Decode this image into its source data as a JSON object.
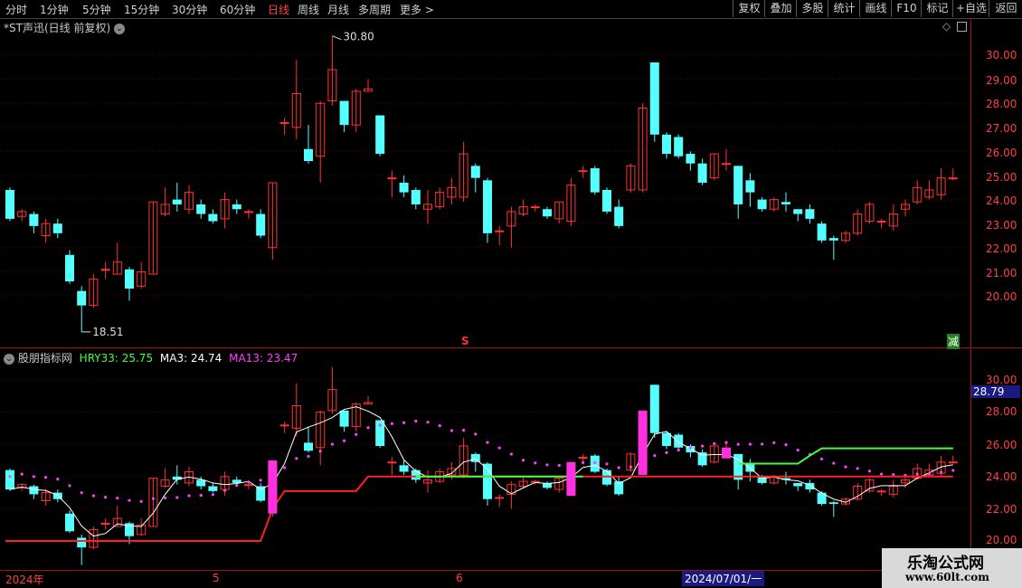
{
  "topbar": {
    "periods": [
      "分时",
      "1分钟",
      "5分钟",
      "15分钟",
      "30分钟",
      "60分钟",
      "日线",
      "周线",
      "月线",
      "多周期",
      "更多 >"
    ],
    "active_period": "日线",
    "right_buttons": [
      "复权",
      "叠加",
      "多股",
      "统计",
      "画线",
      "F10",
      "标记",
      "+自选",
      "返回"
    ]
  },
  "main_chart": {
    "title": "*ST声迅(日线 前复权)",
    "high_label": "30.80",
    "low_label": "18.51",
    "y_ticks": [
      "30.00",
      "29.00",
      "28.00",
      "27.00",
      "26.00",
      "25.00",
      "24.00",
      "23.00",
      "22.00",
      "21.00",
      "20.00"
    ],
    "marker_s": "S",
    "marker_jian": "减"
  },
  "indicator": {
    "name": "股朋指标网",
    "hry_label": "HRY33: 25.75",
    "ma3_label": "MA3: 24.74",
    "ma13_label": "MA13: 23.47",
    "y_ticks": [
      "30.00",
      "28.00",
      "26.00",
      "24.00",
      "22.00",
      "20.00"
    ],
    "current_value": "28.79",
    "colors": {
      "hry": "#40ff40",
      "ma3": "#ffffff",
      "ma13": "#ff40ff",
      "support": "#ff2020"
    }
  },
  "date_axis": {
    "labels": [
      "2024年",
      "5",
      "6",
      "2024/07/01/一"
    ]
  },
  "watermark": {
    "title": "乐淘公式网",
    "url": "www.60lt.com"
  },
  "chart_data": {
    "type": "candlestick",
    "candles": [
      {
        "o": 24.4,
        "c": 23.2,
        "h": 24.5,
        "l": 23.1
      },
      {
        "o": 23.3,
        "c": 23.5,
        "h": 23.6,
        "l": 23.1
      },
      {
        "o": 23.4,
        "c": 22.9,
        "h": 23.5,
        "l": 22.6
      },
      {
        "o": 22.5,
        "c": 23.0,
        "h": 23.2,
        "l": 22.2
      },
      {
        "o": 23.0,
        "c": 22.6,
        "h": 23.2,
        "l": 22.4
      },
      {
        "o": 21.7,
        "c": 20.6,
        "h": 21.9,
        "l": 20.5
      },
      {
        "o": 20.2,
        "c": 19.6,
        "h": 20.4,
        "l": 18.5
      },
      {
        "o": 19.6,
        "c": 20.7,
        "h": 20.9,
        "l": 19.5
      },
      {
        "o": 21.1,
        "c": 21.1,
        "h": 21.4,
        "l": 20.7
      },
      {
        "o": 20.9,
        "c": 21.4,
        "h": 22.2,
        "l": 20.9
      },
      {
        "o": 21.1,
        "c": 20.3,
        "h": 21.2,
        "l": 19.8
      },
      {
        "o": 20.4,
        "c": 21.0,
        "h": 21.4,
        "l": 20.3
      },
      {
        "o": 20.9,
        "c": 23.9,
        "h": 23.9,
        "l": 20.9
      },
      {
        "o": 23.4,
        "c": 23.8,
        "h": 24.5,
        "l": 23.3
      },
      {
        "o": 24.0,
        "c": 23.8,
        "h": 24.7,
        "l": 23.5
      },
      {
        "o": 23.6,
        "c": 24.3,
        "h": 24.6,
        "l": 23.4
      },
      {
        "o": 23.8,
        "c": 23.4,
        "h": 24.0,
        "l": 23.2
      },
      {
        "o": 23.4,
        "c": 23.1,
        "h": 23.6,
        "l": 23.0
      },
      {
        "o": 23.2,
        "c": 24.0,
        "h": 24.3,
        "l": 22.8
      },
      {
        "o": 23.8,
        "c": 23.6,
        "h": 24.0,
        "l": 23.4
      },
      {
        "o": 23.5,
        "c": 23.5,
        "h": 23.6,
        "l": 23.2
      },
      {
        "o": 23.4,
        "c": 22.5,
        "h": 23.6,
        "l": 22.4
      },
      {
        "o": 22.0,
        "c": 24.7,
        "h": 24.7,
        "l": 21.5
      },
      {
        "o": 27.2,
        "c": 27.2,
        "h": 27.4,
        "l": 26.7
      },
      {
        "o": 27.0,
        "c": 28.4,
        "h": 29.8,
        "l": 26.5
      },
      {
        "o": 26.1,
        "c": 25.6,
        "h": 27.1,
        "l": 25.5
      },
      {
        "o": 25.8,
        "c": 28.0,
        "h": 28.1,
        "l": 24.7
      },
      {
        "o": 28.1,
        "c": 29.4,
        "h": 30.8,
        "l": 27.9
      },
      {
        "o": 28.1,
        "c": 27.1,
        "h": 28.1,
        "l": 26.8
      },
      {
        "o": 27.1,
        "c": 28.5,
        "h": 28.6,
        "l": 26.8
      },
      {
        "o": 28.5,
        "c": 28.6,
        "h": 29.0,
        "l": 28.5
      },
      {
        "o": 27.5,
        "c": 25.9,
        "h": 27.5,
        "l": 25.8
      },
      {
        "o": 24.9,
        "c": 24.9,
        "h": 25.2,
        "l": 24.1
      },
      {
        "o": 24.7,
        "c": 24.3,
        "h": 25.0,
        "l": 24.1
      },
      {
        "o": 24.4,
        "c": 23.8,
        "h": 24.5,
        "l": 23.6
      },
      {
        "o": 23.6,
        "c": 23.8,
        "h": 24.4,
        "l": 23.0
      },
      {
        "o": 23.7,
        "c": 24.3,
        "h": 24.5,
        "l": 23.6
      },
      {
        "o": 24.1,
        "c": 24.5,
        "h": 24.9,
        "l": 23.8
      },
      {
        "o": 24.1,
        "c": 25.9,
        "h": 26.4,
        "l": 23.9
      },
      {
        "o": 25.4,
        "c": 24.9,
        "h": 25.5,
        "l": 24.3
      },
      {
        "o": 24.8,
        "c": 22.6,
        "h": 24.9,
        "l": 22.2
      },
      {
        "o": 22.7,
        "c": 22.7,
        "h": 22.9,
        "l": 22.1
      },
      {
        "o": 22.9,
        "c": 23.5,
        "h": 23.7,
        "l": 22.0
      },
      {
        "o": 23.4,
        "c": 23.7,
        "h": 24.0,
        "l": 23.3
      },
      {
        "o": 23.7,
        "c": 23.7,
        "h": 23.8,
        "l": 23.5
      },
      {
        "o": 23.6,
        "c": 23.3,
        "h": 23.7,
        "l": 23.2
      },
      {
        "o": 23.2,
        "c": 23.9,
        "h": 23.9,
        "l": 23.0
      },
      {
        "o": 23.1,
        "c": 24.6,
        "h": 24.9,
        "l": 22.9
      },
      {
        "o": 25.2,
        "c": 25.2,
        "h": 25.4,
        "l": 24.9
      },
      {
        "o": 25.3,
        "c": 24.3,
        "h": 25.4,
        "l": 24.2
      },
      {
        "o": 24.4,
        "c": 23.5,
        "h": 24.5,
        "l": 23.4
      },
      {
        "o": 23.7,
        "c": 22.9,
        "h": 24.0,
        "l": 22.8
      },
      {
        "o": 24.4,
        "c": 25.4,
        "h": 25.5,
        "l": 24.3
      },
      {
        "o": 24.4,
        "c": 27.8,
        "h": 28.0,
        "l": 24.3
      },
      {
        "o": 29.7,
        "c": 26.7,
        "h": 29.7,
        "l": 26.4
      },
      {
        "o": 26.7,
        "c": 25.9,
        "h": 26.8,
        "l": 25.7
      },
      {
        "o": 26.6,
        "c": 25.8,
        "h": 26.7,
        "l": 25.7
      },
      {
        "o": 25.9,
        "c": 25.5,
        "h": 26.0,
        "l": 25.2
      },
      {
        "o": 25.5,
        "c": 24.7,
        "h": 25.7,
        "l": 24.6
      },
      {
        "o": 24.9,
        "c": 25.9,
        "h": 25.9,
        "l": 24.8
      },
      {
        "o": 25.5,
        "c": 25.5,
        "h": 26.1,
        "l": 25.2
      },
      {
        "o": 25.4,
        "c": 23.8,
        "h": 25.4,
        "l": 23.2
      },
      {
        "o": 24.8,
        "c": 24.3,
        "h": 25.1,
        "l": 23.7
      },
      {
        "o": 24.0,
        "c": 23.6,
        "h": 24.1,
        "l": 23.5
      },
      {
        "o": 23.6,
        "c": 24.0,
        "h": 24.1,
        "l": 23.5
      },
      {
        "o": 23.9,
        "c": 23.8,
        "h": 24.3,
        "l": 23.5
      },
      {
        "o": 23.6,
        "c": 23.4,
        "h": 23.6,
        "l": 23.1
      },
      {
        "o": 23.6,
        "c": 23.2,
        "h": 23.8,
        "l": 23.0
      },
      {
        "o": 23.0,
        "c": 22.3,
        "h": 23.1,
        "l": 22.2
      },
      {
        "o": 22.4,
        "c": 22.3,
        "h": 22.5,
        "l": 21.5
      },
      {
        "o": 22.3,
        "c": 22.6,
        "h": 22.7,
        "l": 22.2
      },
      {
        "o": 22.6,
        "c": 23.4,
        "h": 23.6,
        "l": 22.5
      },
      {
        "o": 23.1,
        "c": 23.8,
        "h": 23.9,
        "l": 23.0
      },
      {
        "o": 23.1,
        "c": 23.1,
        "h": 23.2,
        "l": 22.8
      },
      {
        "o": 22.9,
        "c": 23.4,
        "h": 23.8,
        "l": 22.7
      },
      {
        "o": 23.6,
        "c": 23.8,
        "h": 24.0,
        "l": 23.3
      },
      {
        "o": 23.9,
        "c": 24.5,
        "h": 24.8,
        "l": 23.8
      },
      {
        "o": 24.1,
        "c": 24.4,
        "h": 24.8,
        "l": 24.0
      },
      {
        "o": 24.2,
        "c": 24.9,
        "h": 25.3,
        "l": 24.0
      },
      {
        "o": 24.9,
        "c": 24.9,
        "h": 25.3,
        "l": 24.8
      }
    ]
  }
}
